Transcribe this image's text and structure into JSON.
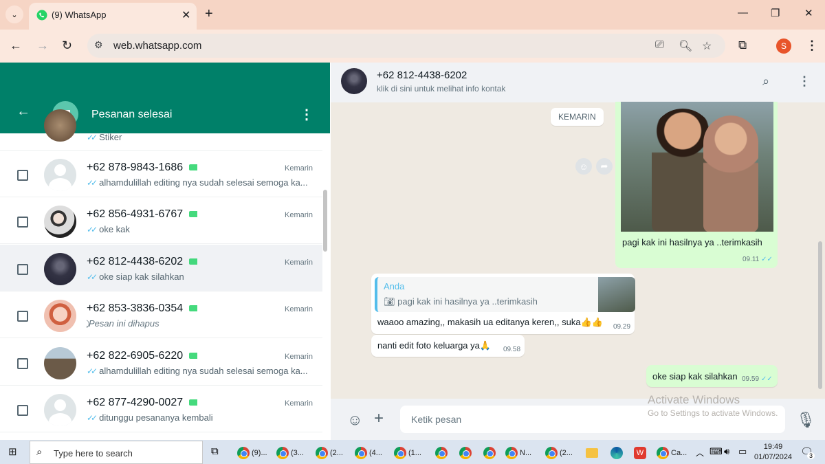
{
  "browser": {
    "tab_title": "(9) WhatsApp",
    "url": "web.whatsapp.com",
    "profile_initial": "S"
  },
  "sidebar": {
    "title": "Pesanan selesai",
    "top_partial_msg": "Stiker",
    "chats": [
      {
        "name": "+62 878-9843-1686",
        "time": "Kemarin",
        "message": "alhamdulillah editing nya sudah selesai semoga ka...",
        "deleted": false,
        "selected": false,
        "avatar": "blank"
      },
      {
        "name": "+62 856-4931-6767",
        "time": "Kemarin",
        "message": "oke kak",
        "deleted": false,
        "selected": false,
        "avatar": "photo1"
      },
      {
        "name": "+62 812-4438-6202",
        "time": "Kemarin",
        "message": "oke siap kak silahkan",
        "deleted": false,
        "selected": true,
        "avatar": "photo2"
      },
      {
        "name": "+62 853-3836-0354",
        "time": "Kemarin",
        "message": "Pesan ini dihapus",
        "deleted": true,
        "selected": false,
        "avatar": "photo3"
      },
      {
        "name": "+62 822-6905-6220",
        "time": "Kemarin",
        "message": "alhamdulillah editing nya sudah selesai semoga ka...",
        "deleted": false,
        "selected": false,
        "avatar": "photo4"
      },
      {
        "name": "+62 877-4290-0027",
        "time": "Kemarin",
        "message": "ditunggu pesananya kembali",
        "deleted": false,
        "selected": false,
        "avatar": "blank"
      }
    ]
  },
  "chat": {
    "contact_name": "+62 812-4438-6202",
    "contact_sub": "klik di sini untuk melihat info kontak",
    "date_chip": "KEMARIN",
    "messages": {
      "image_caption": "pagi kak ini hasilnya ya ..terimkasih",
      "image_time": "09.11",
      "quote_author": "Anda",
      "quote_text": "pagi kak ini hasilnya ya ..terimkasih",
      "reply_text": "waaoo amazing,, makasih ua editanya keren,, suka👍👍",
      "reply_time": "09.29",
      "in2_text": "nanti edit foto keluarga ya🙏",
      "in2_time": "09.58",
      "out2_text": "oke siap kak silahkan",
      "out2_time": "09.59"
    },
    "composer_placeholder": "Ketik pesan"
  },
  "watermark": {
    "title": "Activate Windows",
    "subtitle": "Go to Settings to activate Windows."
  },
  "taskbar": {
    "search_placeholder": "Type here to search",
    "apps": [
      "(9)...",
      "(3...",
      "(2...",
      "(4...",
      "(1...",
      "N...",
      "(2...",
      "Ca..."
    ],
    "time": "19:49",
    "date": "01/07/2024",
    "notification_count": "3"
  },
  "colors": {
    "header_green": "#008069",
    "tick_blue": "#53bdeb",
    "outgoing_bubble": "#d9fdd3"
  }
}
